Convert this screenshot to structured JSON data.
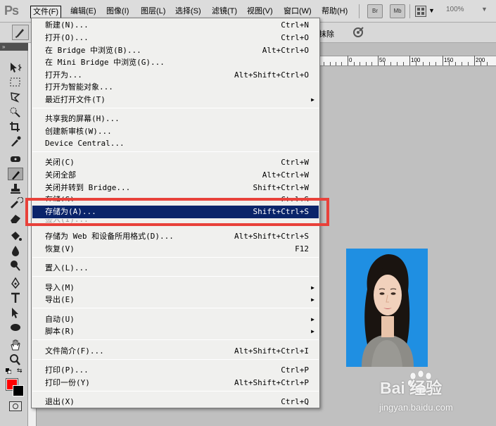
{
  "app": {
    "logo": "Ps"
  },
  "menubar": {
    "items": [
      "文件(F)",
      "编辑(E)",
      "图像(I)",
      "图层(L)",
      "选择(S)",
      "滤镜(T)",
      "视图(V)",
      "窗口(W)",
      "帮助(H)"
    ],
    "active_index": 0,
    "buttons": [
      "Br",
      "Mb"
    ],
    "zoom": "100%"
  },
  "options": {
    "erase_label": "抹除"
  },
  "ruler": {
    "labels": [
      "0",
      "50",
      "100",
      "150",
      "200"
    ]
  },
  "file_menu": {
    "items": [
      {
        "label": "新建(N)...",
        "shortcut": "Ctrl+N"
      },
      {
        "label": "打开(O)...",
        "shortcut": "Ctrl+O"
      },
      {
        "label": "在 Bridge 中浏览(B)...",
        "shortcut": "Alt+Ctrl+O"
      },
      {
        "label": "在 Mini Bridge 中浏览(G)...",
        "shortcut": ""
      },
      {
        "label": "打开为...",
        "shortcut": "Alt+Shift+Ctrl+O"
      },
      {
        "label": "打开为智能对象...",
        "shortcut": ""
      },
      {
        "label": "最近打开文件(T)",
        "shortcut": "",
        "submenu": true
      },
      {
        "label": "共享我的屏幕(H)...",
        "shortcut": ""
      },
      {
        "label": "创建新审核(W)...",
        "shortcut": ""
      },
      {
        "label": "Device Central...",
        "shortcut": ""
      },
      {
        "label": "关闭(C)",
        "shortcut": "Ctrl+W"
      },
      {
        "label": "关闭全部",
        "shortcut": "Alt+Ctrl+W"
      },
      {
        "label": "关闭并转到 Bridge...",
        "shortcut": "Shift+Ctrl+W"
      },
      {
        "label": "存储(S)",
        "shortcut": "Ctrl+S"
      },
      {
        "label": "存储为(A)...",
        "shortcut": "Shift+Ctrl+S",
        "highlighted": true
      },
      {
        "label": "签入(I)...",
        "shortcut": "",
        "disabled": true
      },
      {
        "label": "存储为 Web 和设备所用格式(D)...",
        "shortcut": "Alt+Shift+Ctrl+S"
      },
      {
        "label": "恢复(V)",
        "shortcut": "F12"
      },
      {
        "label": "置入(L)...",
        "shortcut": ""
      },
      {
        "label": "导入(M)",
        "shortcut": "",
        "submenu": true
      },
      {
        "label": "导出(E)",
        "shortcut": "",
        "submenu": true
      },
      {
        "label": "自动(U)",
        "shortcut": "",
        "submenu": true
      },
      {
        "label": "脚本(R)",
        "shortcut": "",
        "submenu": true
      },
      {
        "label": "文件简介(F)...",
        "shortcut": "Alt+Shift+Ctrl+I"
      },
      {
        "label": "打印(P)...",
        "shortcut": "Ctrl+P"
      },
      {
        "label": "打印一份(Y)",
        "shortcut": "Alt+Shift+Ctrl+P"
      },
      {
        "label": "退出(X)",
        "shortcut": "Ctrl+Q"
      }
    ]
  },
  "colors": {
    "foreground": "#ff0000",
    "background": "#000000",
    "highlight": "#0a246a",
    "annotation": "#e8413a"
  },
  "watermark": {
    "brand": "Bai 经验",
    "url": "jingyan.baidu.com"
  }
}
